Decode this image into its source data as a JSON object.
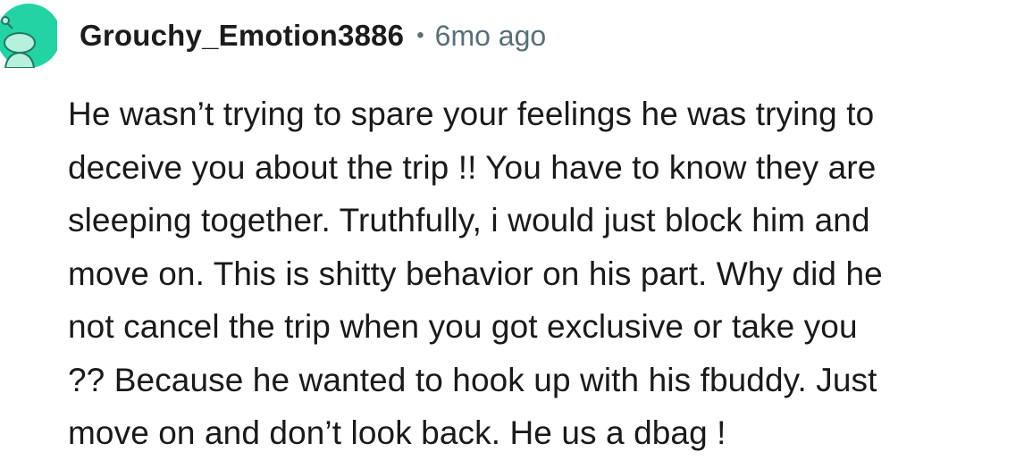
{
  "comment": {
    "author": "Grouchy_Emotion3886",
    "separator": "•",
    "timestamp": "6mo ago",
    "avatar_color": "#24d3a4",
    "body_lines": [
      "He wasn’t trying to spare your feelings he was trying to",
      "deceive you about the trip !! You have to know they are",
      "sleeping together. Truthfully, i would just block him and",
      "move on. This is shitty behavior on his part. Why did he",
      "not cancel the trip when you got exclusive or take you",
      "?? Because he wanted to hook up with his fbuddy. Just",
      "move on and don’t look back. He us a dbag !"
    ]
  }
}
